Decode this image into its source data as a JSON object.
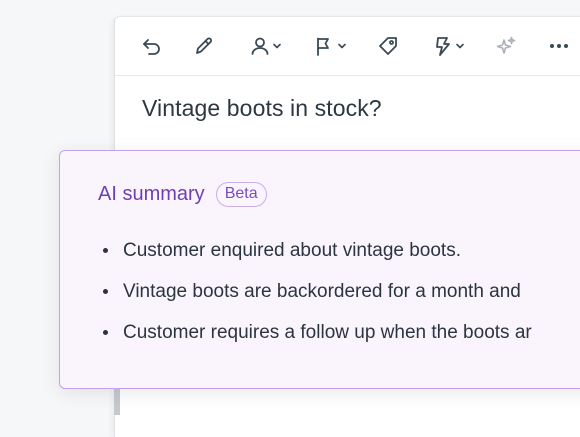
{
  "toolbar": {
    "tools": [
      {
        "icon": "undo-icon"
      },
      {
        "icon": "pencil-icon"
      },
      {
        "icon": "user-icon",
        "has_dropdown": true
      },
      {
        "icon": "flag-icon",
        "has_dropdown": true
      },
      {
        "icon": "tag-icon"
      },
      {
        "icon": "lightning-icon",
        "has_dropdown": true
      },
      {
        "icon": "sparkle-icon"
      },
      {
        "icon": "more-icon"
      }
    ]
  },
  "ticket": {
    "subject": "Vintage boots in stock?"
  },
  "ai_summary": {
    "title": "AI summary",
    "badge": "Beta",
    "bullets": [
      "Customer enquired about vintage boots.",
      "Vintage boots are backordered for a month and",
      "Customer requires a follow up when the boots ar"
    ]
  },
  "colors": {
    "accent": "#6e3fb0",
    "card_border": "#c2a3e8",
    "card_background": "#faf5fd",
    "icon": "#3a4a55"
  }
}
